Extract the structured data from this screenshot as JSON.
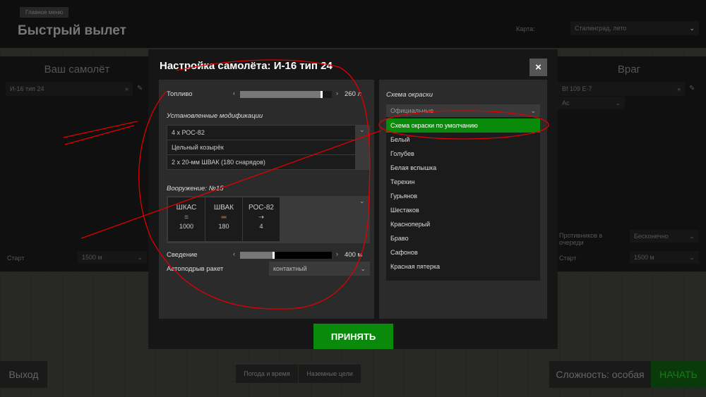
{
  "breadcrumb": "Главное меню",
  "page_title": "Быстрый вылет",
  "map_label": "Карта:",
  "map_value": "Сталинград, лето",
  "left_panel": {
    "title": "Ваш самолёт",
    "aircraft": "И-16 тип 24",
    "start_label": "Старт",
    "start_value": "1500 м"
  },
  "right_panel": {
    "title": "Враг",
    "aircraft": "Bf 109 E-7",
    "skill": "Ас",
    "queue_label": "Противников в очереди",
    "queue_value": "Бесконечно",
    "start_label": "Старт",
    "start_value": "1500 м"
  },
  "modal": {
    "title": "Настройка самолёта: И-16 тип 24",
    "close": "×",
    "fuel_label": "Топливо",
    "fuel_value": "260 л",
    "fuel_fraction": 0.9,
    "mods_title": "Установленные модификации",
    "mods": [
      "4 х РОС-82",
      "Цельный козырёк",
      "2 х 20-мм ШВАК (180 снарядов)"
    ],
    "weapons_title": "Вооружение: №15",
    "weapons": [
      {
        "name": "ШКАС",
        "count": "1000"
      },
      {
        "name": "ШВАК",
        "count": "180"
      },
      {
        "name": "РОС-82",
        "count": "4"
      }
    ],
    "convergence_label": "Сведение",
    "convergence_value": "400 м",
    "convergence_fraction": 0.38,
    "rocket_label": "Автоподрыв ракет",
    "rocket_value": "контактный",
    "skin_title": "Схема окраски",
    "skin_filter": "Официальные",
    "skins": [
      "Схема окраски по умолчанию",
      "Белый",
      "Голубев",
      "Белая вспышка",
      "Терехин",
      "Гурьянов",
      "Шестаков",
      "Красноперый",
      "Браво",
      "Сафонов",
      "Красная пятерка"
    ],
    "accept": "ПРИНЯТЬ"
  },
  "bottom": {
    "exit": "Выход",
    "weather": "Погода и время",
    "ground": "Наземные цели",
    "difficulty": "Сложность: особая",
    "start": "НАЧАТЬ"
  },
  "colors": {
    "accent": "#0a8a0a",
    "annotation": "#e00000"
  }
}
